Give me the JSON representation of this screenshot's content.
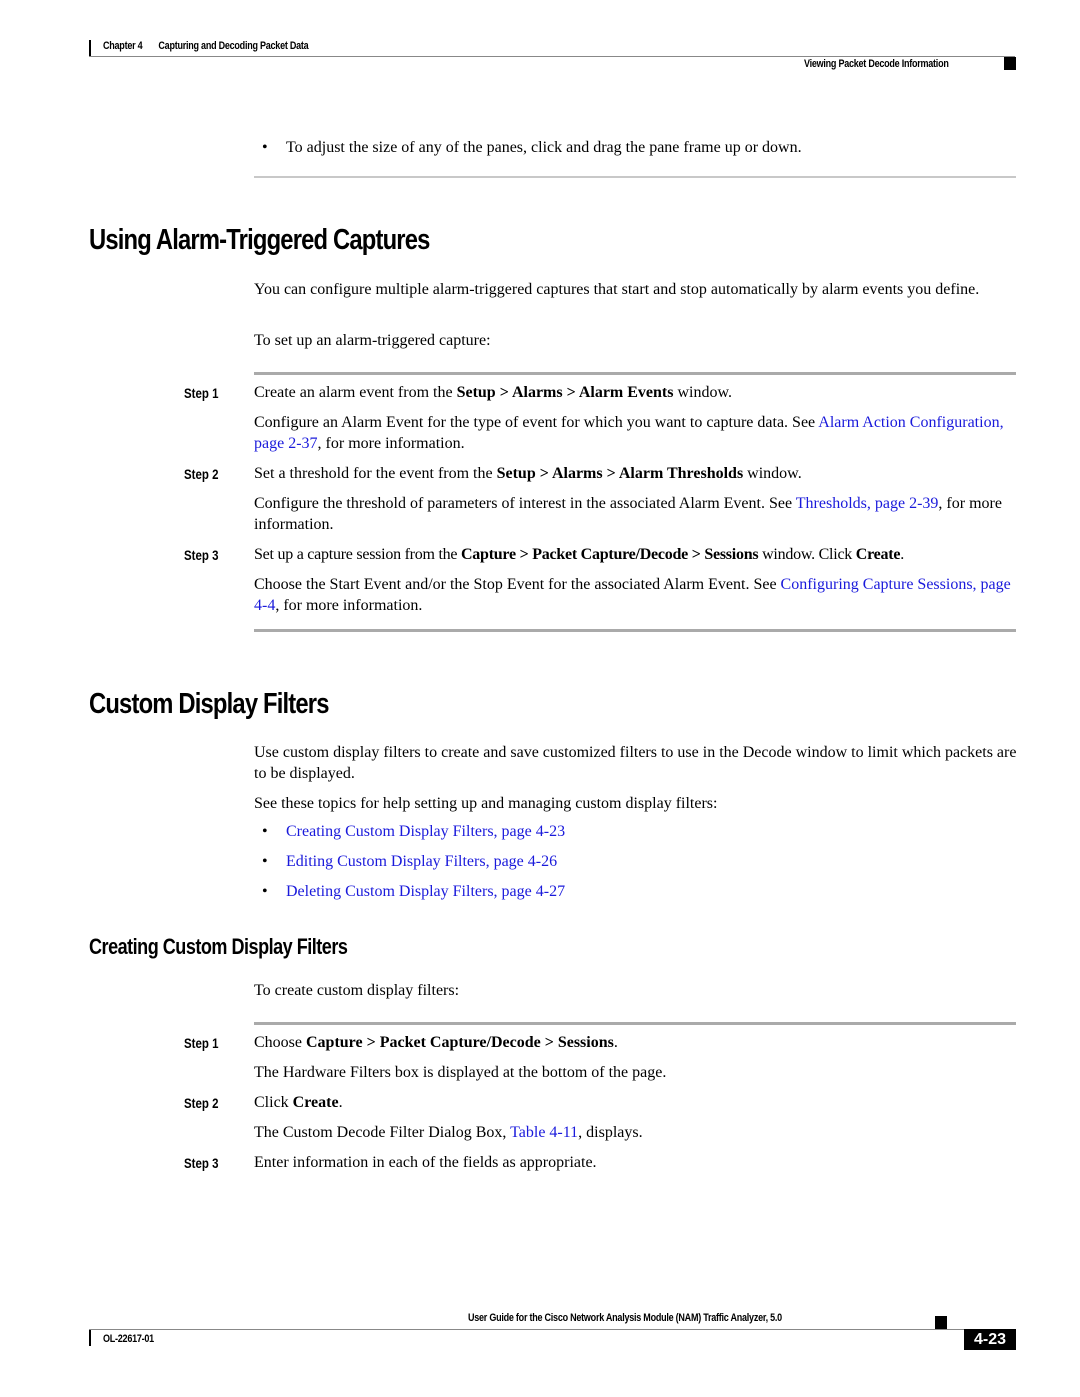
{
  "header": {
    "chapter": "Chapter 4",
    "chapter_title": "Capturing and Decoding Packet Data",
    "section_title": "Viewing Packet Decode Information"
  },
  "intro_bullet": "To adjust the size of any of the panes, click and drag the pane frame up or down.",
  "section1": {
    "title": "Using Alarm-Triggered Captures",
    "para1": "You can configure multiple alarm-triggered captures that start and stop automatically by alarm events you define.",
    "para2": "To set up an alarm-triggered capture:",
    "steps": [
      {
        "label": "Step 1",
        "pre": "Create an alarm event from the ",
        "bold": "Setup > Alarms > Alarm Events",
        "post": " window.",
        "detail_pre": "Configure an Alarm Event for the type of event for which you want to capture data. See ",
        "detail_link": "Alarm Action Configuration, page 2-37",
        "detail_post": ", for more information."
      },
      {
        "label": "Step 2",
        "pre": "Set a threshold for the event from the ",
        "bold": "Setup > Alarms > Alarm Thresholds",
        "post": " window.",
        "detail_pre": "Configure the threshold of parameters of interest in the associated Alarm Event. See ",
        "detail_link": "Thresholds, page 2-39",
        "detail_post": ", for more information."
      },
      {
        "label": "Step 3",
        "pre": "Set up a capture session from the ",
        "bold": "Capture > Packet Capture/Decode > Sessions",
        "post": " window. Click ",
        "bold2": "Create",
        "post2": ".",
        "detail_pre": "Choose the Start Event and/or the Stop Event for the associated Alarm Event. See ",
        "detail_link": "Configuring Capture Sessions, page 4-4",
        "detail_post": ", for more information."
      }
    ]
  },
  "section2": {
    "title": "Custom Display Filters",
    "para1": "Use custom display filters to create and save customized filters to use in the Decode window to limit which packets are to be displayed.",
    "para2": "See these topics for help setting up and managing custom display filters:",
    "links": [
      "Creating Custom Display Filters, page 4-23",
      "Editing Custom Display Filters, page 4-26",
      "Deleting Custom Display Filters, page 4-27"
    ]
  },
  "section3": {
    "title": "Creating Custom Display Filters",
    "para1": "To create custom display filters:",
    "steps": [
      {
        "label": "Step 1",
        "pre": "Choose ",
        "bold": "Capture > Packet Capture/Decode > Sessions",
        "post": ".",
        "detail": "The Hardware Filters box is displayed at the bottom of the page."
      },
      {
        "label": "Step 2",
        "pre": "Click ",
        "bold": "Create",
        "post": ".",
        "detail_pre": "The Custom Decode Filter Dialog Box, ",
        "detail_link": "Table 4-11",
        "detail_post": ", displays."
      },
      {
        "label": "Step 3",
        "text": "Enter information in each of the fields as appropriate."
      }
    ]
  },
  "footer": {
    "guide_title": "User Guide for the Cisco Network Analysis Module (NAM) Traffic Analyzer, 5.0",
    "doc_number": "OL-22617-01",
    "page_number": "4-23"
  },
  "colors": {
    "link": "#1a1adb",
    "text": "#000000"
  }
}
